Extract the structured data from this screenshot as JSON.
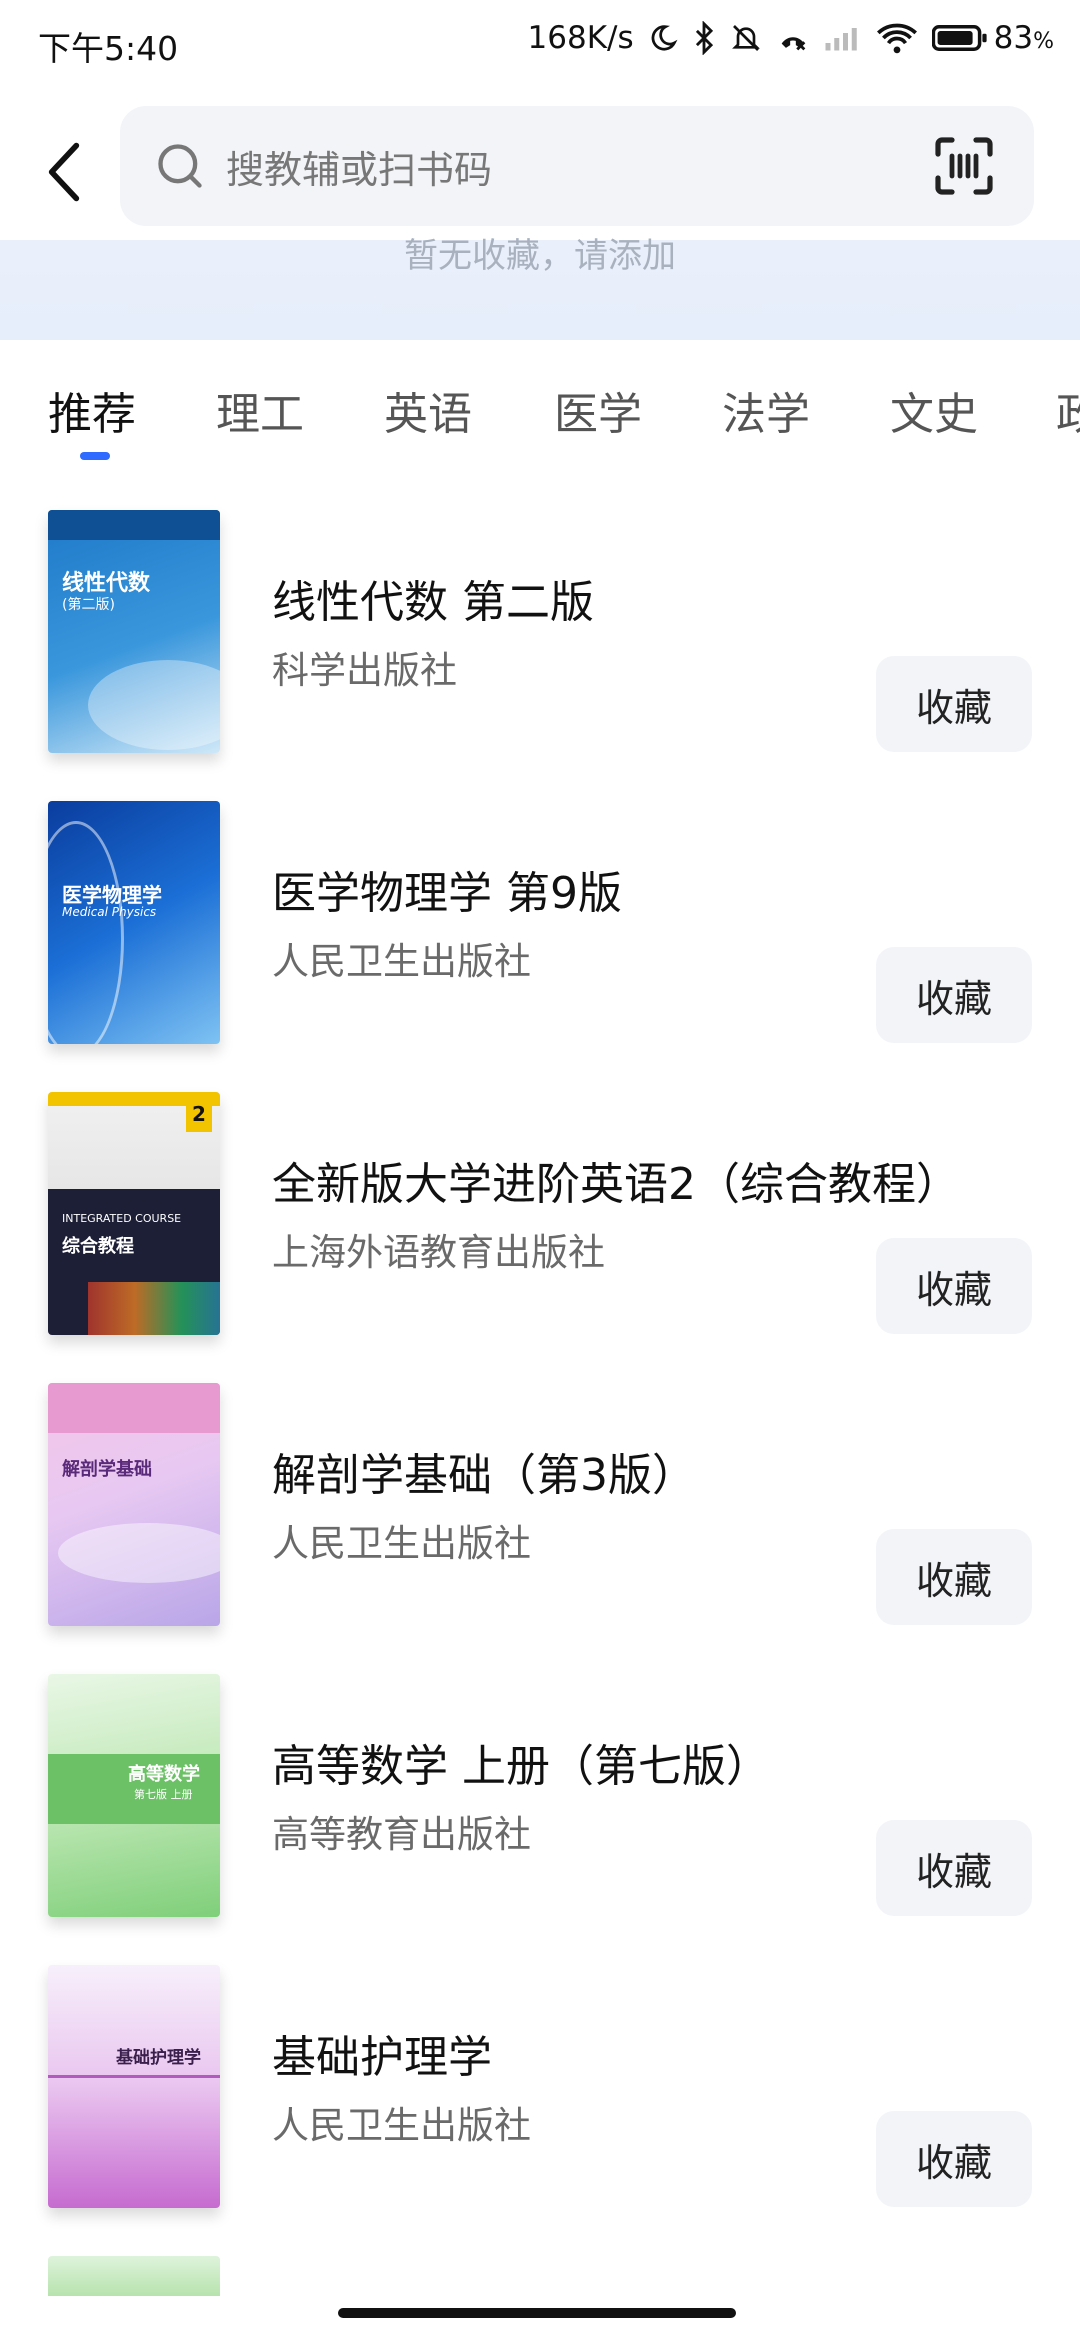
{
  "status_bar": {
    "time": "下午5:40",
    "speed": "168K/s",
    "battery": "83",
    "battery_unit": "%"
  },
  "search": {
    "placeholder": "搜教辅或扫书码"
  },
  "favorites": {
    "empty_text": "暂无收藏，请添加"
  },
  "tabs": [
    {
      "label": "推荐",
      "active": true
    },
    {
      "label": "理工"
    },
    {
      "label": "英语"
    },
    {
      "label": "医学"
    },
    {
      "label": "法学"
    },
    {
      "label": "文史"
    },
    {
      "label": "政"
    }
  ],
  "books": [
    {
      "title": "线性代数 第二版",
      "publisher": "科学出版社",
      "button": "收藏",
      "cover_text": "线性代数",
      "cover_sub": "(第二版)"
    },
    {
      "title": "医学物理学 第9版",
      "publisher": "人民卫生出版社",
      "button": "收藏",
      "cover_text": "医学物理学",
      "cover_sub": "Medical Physics"
    },
    {
      "title": "全新版大学进阶英语2（综合教程）",
      "publisher": "上海外语教育出版社",
      "button": "收藏",
      "cover_text": "综合教程",
      "cover_sub": "INTEGRATED COURSE"
    },
    {
      "title": "解剖学基础（第3版）",
      "publisher": "人民卫生出版社",
      "button": "收藏",
      "cover_text": "解剖学基础",
      "cover_sub": ""
    },
    {
      "title": "高等数学 上册（第七版）",
      "publisher": "高等教育出版社",
      "button": "收藏",
      "cover_text": "高等数学",
      "cover_sub": "第七版 上册"
    },
    {
      "title": "基础护理学",
      "publisher": "人民卫生出版社",
      "button": "收藏",
      "cover_text": "基础护理学",
      "cover_sub": ""
    }
  ],
  "colors": {
    "accent": "#2f6bff",
    "button_bg": "#f2f4f8",
    "search_bg": "#f2f4f7"
  }
}
